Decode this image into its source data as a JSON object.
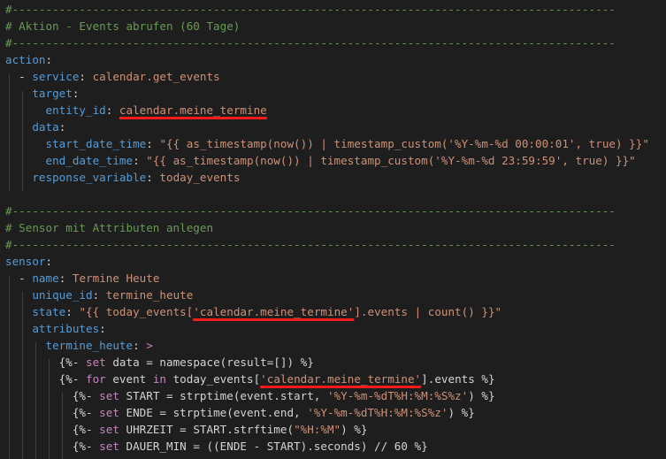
{
  "lines": [
    {
      "segments": [
        {
          "t": "#------------------------------------------------------------------------------------------",
          "c": "c"
        }
      ]
    },
    {
      "segments": [
        {
          "t": "# Aktion - Events abrufen (60 Tage)",
          "c": "c"
        }
      ]
    },
    {
      "segments": [
        {
          "t": "#------------------------------------------------------------------------------------------",
          "c": "c"
        }
      ]
    },
    {
      "segments": [
        {
          "t": "action",
          "c": "k"
        },
        {
          "t": ":",
          "c": "p"
        }
      ]
    },
    {
      "segments": [
        {
          "t": "  - ",
          "c": "p"
        },
        {
          "t": "service",
          "c": "k"
        },
        {
          "t": ": ",
          "c": "p"
        },
        {
          "t": "calendar.get_events",
          "c": "v"
        }
      ]
    },
    {
      "segments": [
        {
          "t": "    ",
          "c": "p"
        },
        {
          "t": "target",
          "c": "k"
        },
        {
          "t": ":",
          "c": "p"
        }
      ]
    },
    {
      "segments": [
        {
          "t": "      ",
          "c": "p"
        },
        {
          "t": "entity_id",
          "c": "k"
        },
        {
          "t": ": ",
          "c": "p"
        },
        {
          "t": "calendar.meine_termine",
          "c": "v",
          "u": true
        }
      ]
    },
    {
      "segments": [
        {
          "t": "    ",
          "c": "p"
        },
        {
          "t": "data",
          "c": "k"
        },
        {
          "t": ":",
          "c": "p"
        }
      ]
    },
    {
      "segments": [
        {
          "t": "      ",
          "c": "p"
        },
        {
          "t": "start_date_time",
          "c": "k"
        },
        {
          "t": ": ",
          "c": "p"
        },
        {
          "t": "\"{{ as_timestamp(now()) | timestamp_custom('%Y-%m-%d 00:00:01', true) }}\"",
          "c": "v"
        }
      ]
    },
    {
      "segments": [
        {
          "t": "      ",
          "c": "p"
        },
        {
          "t": "end_date_time",
          "c": "k"
        },
        {
          "t": ": ",
          "c": "p"
        },
        {
          "t": "\"{{ as_timestamp(now()) | timestamp_custom('%Y-%m-%d 23:59:59', true) }}\"",
          "c": "v"
        }
      ]
    },
    {
      "segments": [
        {
          "t": "    ",
          "c": "p"
        },
        {
          "t": "response_variable",
          "c": "k"
        },
        {
          "t": ": ",
          "c": "p"
        },
        {
          "t": "today_events",
          "c": "v"
        }
      ]
    },
    {
      "segments": [
        {
          "t": "",
          "c": "p"
        }
      ]
    },
    {
      "segments": [
        {
          "t": "#------------------------------------------------------------------------------------------",
          "c": "c"
        }
      ]
    },
    {
      "segments": [
        {
          "t": "# Sensor mit Attributen anlegen",
          "c": "c"
        }
      ]
    },
    {
      "segments": [
        {
          "t": "#------------------------------------------------------------------------------------------",
          "c": "c"
        }
      ]
    },
    {
      "segments": [
        {
          "t": "sensor",
          "c": "k"
        },
        {
          "t": ":",
          "c": "p"
        }
      ]
    },
    {
      "segments": [
        {
          "t": "  - ",
          "c": "p"
        },
        {
          "t": "name",
          "c": "k"
        },
        {
          "t": ": ",
          "c": "p"
        },
        {
          "t": "Termine Heute",
          "c": "v"
        }
      ]
    },
    {
      "segments": [
        {
          "t": "    ",
          "c": "p"
        },
        {
          "t": "unique_id",
          "c": "k"
        },
        {
          "t": ": ",
          "c": "p"
        },
        {
          "t": "termine_heute",
          "c": "v"
        }
      ]
    },
    {
      "segments": [
        {
          "t": "    ",
          "c": "p"
        },
        {
          "t": "state",
          "c": "k"
        },
        {
          "t": ": ",
          "c": "p"
        },
        {
          "t": "\"{{ today_events[",
          "c": "v"
        },
        {
          "t": "'calendar.meine_termine'",
          "c": "v",
          "u": true
        },
        {
          "t": "].events | count() }}\"",
          "c": "v"
        }
      ]
    },
    {
      "segments": [
        {
          "t": "    ",
          "c": "p"
        },
        {
          "t": "attributes",
          "c": "k"
        },
        {
          "t": ":",
          "c": "p"
        }
      ]
    },
    {
      "segments": [
        {
          "t": "      ",
          "c": "p"
        },
        {
          "t": "termine_heute",
          "c": "k"
        },
        {
          "t": ": ",
          "c": "p"
        },
        {
          "t": ">",
          "c": "kw"
        }
      ]
    },
    {
      "segments": [
        {
          "t": "        ",
          "c": "p"
        },
        {
          "t": "{%- ",
          "c": "p"
        },
        {
          "t": "set",
          "c": "kw"
        },
        {
          "t": " data = namespace(result=[]) %}",
          "c": "p"
        }
      ]
    },
    {
      "segments": [
        {
          "t": "        ",
          "c": "p"
        },
        {
          "t": "{%- ",
          "c": "p"
        },
        {
          "t": "for",
          "c": "kw"
        },
        {
          "t": " event ",
          "c": "p"
        },
        {
          "t": "in",
          "c": "kw"
        },
        {
          "t": " today_events[",
          "c": "p"
        },
        {
          "t": "'calendar.meine_termine'",
          "c": "v",
          "u": true
        },
        {
          "t": "].events %}",
          "c": "p"
        }
      ]
    },
    {
      "segments": [
        {
          "t": "          ",
          "c": "p"
        },
        {
          "t": "{%- ",
          "c": "p"
        },
        {
          "t": "set",
          "c": "kw"
        },
        {
          "t": " START = strptime(event.start, ",
          "c": "p"
        },
        {
          "t": "'%Y-%m-%dT%H:%M:%S%z'",
          "c": "v"
        },
        {
          "t": ") %}",
          "c": "p"
        }
      ]
    },
    {
      "segments": [
        {
          "t": "          ",
          "c": "p"
        },
        {
          "t": "{%- ",
          "c": "p"
        },
        {
          "t": "set",
          "c": "kw"
        },
        {
          "t": " ENDE = strptime(event.end, ",
          "c": "p"
        },
        {
          "t": "'%Y-%m-%dT%H:%M:%S%z'",
          "c": "v"
        },
        {
          "t": ") %}",
          "c": "p"
        }
      ]
    },
    {
      "segments": [
        {
          "t": "          ",
          "c": "p"
        },
        {
          "t": "{%- ",
          "c": "p"
        },
        {
          "t": "set",
          "c": "kw"
        },
        {
          "t": " UHRZEIT = START.strftime(",
          "c": "p"
        },
        {
          "t": "\"%H:%M\"",
          "c": "v"
        },
        {
          "t": ") %}",
          "c": "p"
        }
      ]
    },
    {
      "segments": [
        {
          "t": "          ",
          "c": "p"
        },
        {
          "t": "{%- ",
          "c": "p"
        },
        {
          "t": "set",
          "c": "kw"
        },
        {
          "t": " DAUER_MIN = ((ENDE - START).seconds) // 60 %}",
          "c": "p"
        }
      ]
    }
  ]
}
